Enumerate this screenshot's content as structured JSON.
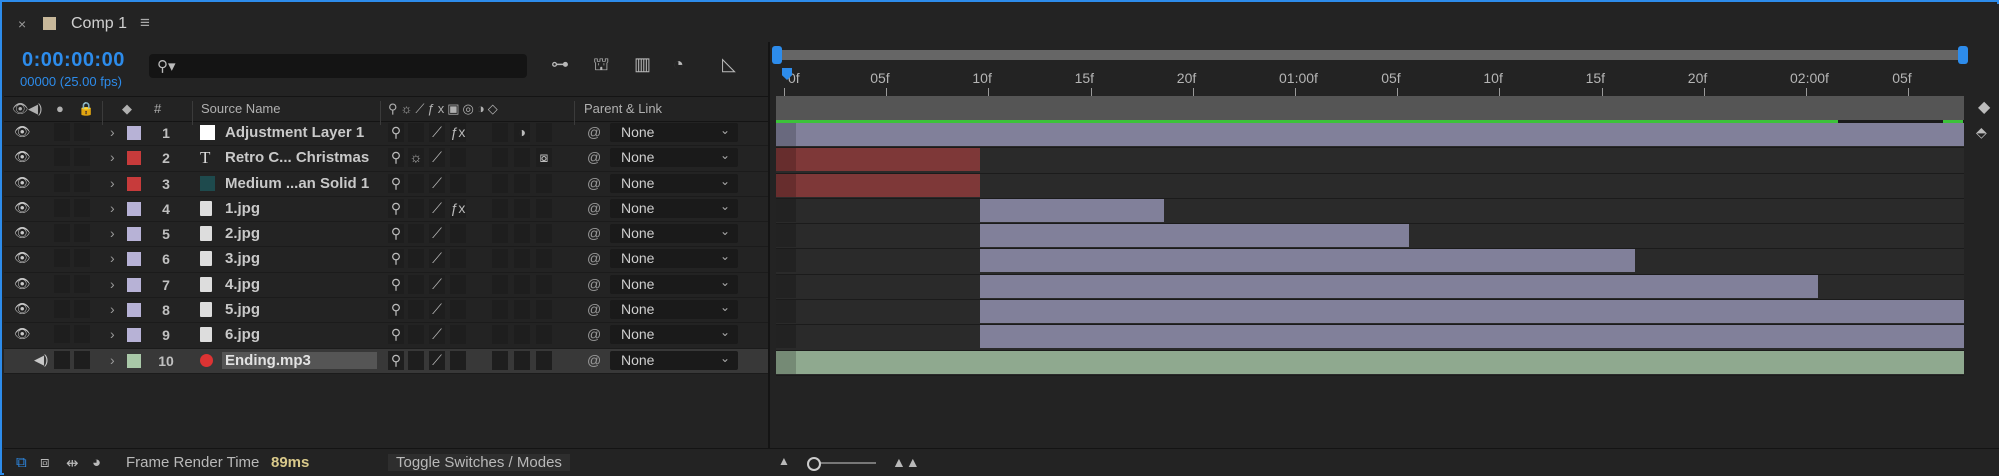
{
  "tab": {
    "name": "Comp 1",
    "close": "×",
    "menu": "≡"
  },
  "time": {
    "timecode": "0:00:00:00",
    "frames": "00000 (25.00 fps)"
  },
  "search": {
    "placeholder": ""
  },
  "columns": {
    "source_name": "Source Name",
    "number": "#",
    "parent_link": "Parent & Link"
  },
  "layers": [
    {
      "num": "1",
      "name": "Adjustment Layer 1",
      "label_color": "#b7b2d6",
      "icon": "white-solid-icon",
      "parent": "None",
      "start": 0,
      "end": 1.0,
      "bar_color": "#81809a"
    },
    {
      "num": "2",
      "name": "Retro C... Christmas",
      "label_color": "#c73b3b",
      "icon": "text-layer-icon",
      "parent": "None",
      "start": 0,
      "end": 0.172,
      "bar_color": "#7e3838"
    },
    {
      "num": "3",
      "name": "Medium ...an Solid 1",
      "label_color": "#c73b3b",
      "icon": "teal-solid-icon",
      "parent": "None",
      "start": 0,
      "end": 0.172,
      "bar_color": "#7e3838"
    },
    {
      "num": "4",
      "name": "1.jpg",
      "label_color": "#b7b2d6",
      "icon": "image-file-icon",
      "parent": "None",
      "start": 0.172,
      "end": 0.327,
      "bar_color": "#81809a"
    },
    {
      "num": "5",
      "name": "2.jpg",
      "label_color": "#b7b2d6",
      "icon": "image-file-icon",
      "parent": "None",
      "start": 0.172,
      "end": 0.533,
      "bar_color": "#81809a"
    },
    {
      "num": "6",
      "name": "3.jpg",
      "label_color": "#b7b2d6",
      "icon": "image-file-icon",
      "parent": "None",
      "start": 0.172,
      "end": 0.723,
      "bar_color": "#81809a"
    },
    {
      "num": "7",
      "name": "4.jpg",
      "label_color": "#b7b2d6",
      "icon": "image-file-icon",
      "parent": "None",
      "start": 0.172,
      "end": 0.877,
      "bar_color": "#81809a"
    },
    {
      "num": "8",
      "name": "5.jpg",
      "label_color": "#b7b2d6",
      "icon": "image-file-icon",
      "parent": "None",
      "start": 0.172,
      "end": 1.0,
      "bar_color": "#81809a"
    },
    {
      "num": "9",
      "name": "6.jpg",
      "label_color": "#b7b2d6",
      "icon": "image-file-icon",
      "parent": "None",
      "start": 0.172,
      "end": 1.0,
      "bar_color": "#81809a"
    },
    {
      "num": "10",
      "name": "Ending.mp3",
      "label_color": "#a9c8a8",
      "icon": "audio-file-icon",
      "parent": "None",
      "start": 0,
      "end": 1.0,
      "bar_color": "#8fa98f",
      "selected": true
    }
  ],
  "ruler_ticks": [
    "0f",
    "05f",
    "10f",
    "15f",
    "20f",
    "01:00f",
    "05f",
    "10f",
    "15f",
    "20f",
    "02:00f",
    "05f"
  ],
  "bottom": {
    "render_label": "Frame Render Time",
    "render_value": "89ms",
    "toggle": "Toggle Switches / Modes"
  },
  "colors": {
    "accent": "#2d8ceb",
    "cache": "#3cc23a",
    "render_value": "#d9c98a"
  }
}
